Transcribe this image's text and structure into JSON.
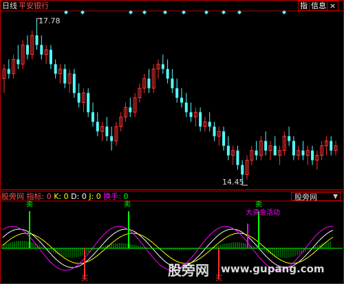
{
  "header": {
    "period": "日线",
    "stock_name": "平安银行",
    "btn_index": "指",
    "btn_info": "信息",
    "btn_close": "×"
  },
  "price_chart": {
    "high_label": "17.78",
    "low_label": "14.45",
    "colors": {
      "up": "#ff3232",
      "down": "#54ffff",
      "frame": "#c00000",
      "marker": "#54ffff"
    }
  },
  "indicator": {
    "source": "股旁网",
    "label_prefix": "指标:",
    "k_label": "0",
    "k_name": "K:",
    "d_name": "D:",
    "d_label": "0",
    "j_name": "J:",
    "j_label": "0",
    "turnover_name": "换手:",
    "turnover_value": "0",
    "selector": "股旁网",
    "sell_label": "卖",
    "buy_label": "买",
    "annotation": "大资金活动",
    "colors": {
      "k": "#ffffff",
      "d": "#ffff00",
      "j": "#ff00ff",
      "turnover": "#00ff00",
      "sell": "#00ff00",
      "buy": "#ff3232",
      "annotation": "#ff00ff"
    }
  },
  "watermark": {
    "text": "股旁网",
    "url": "www.gupang.com"
  },
  "chart_data": {
    "type": "candlestick",
    "high": 17.78,
    "low": 14.45,
    "ohlc": [
      [
        16.6,
        16.9,
        16.3,
        16.8
      ],
      [
        16.8,
        17.0,
        16.6,
        16.7
      ],
      [
        16.7,
        17.1,
        16.6,
        17.0
      ],
      [
        17.0,
        17.3,
        16.8,
        16.9
      ],
      [
        16.9,
        17.4,
        16.8,
        17.3
      ],
      [
        17.3,
        17.5,
        17.0,
        17.1
      ],
      [
        17.1,
        17.6,
        17.0,
        17.5
      ],
      [
        17.5,
        17.78,
        17.2,
        17.3
      ],
      [
        17.3,
        17.5,
        17.0,
        17.1
      ],
      [
        17.1,
        17.3,
        16.9,
        17.2
      ],
      [
        17.2,
        17.3,
        16.8,
        16.9
      ],
      [
        16.9,
        17.0,
        16.6,
        16.7
      ],
      [
        16.7,
        16.9,
        16.5,
        16.8
      ],
      [
        16.8,
        16.9,
        16.4,
        16.5
      ],
      [
        16.5,
        16.8,
        16.3,
        16.7
      ],
      [
        16.7,
        16.8,
        16.2,
        16.3
      ],
      [
        16.3,
        16.5,
        16.0,
        16.1
      ],
      [
        16.1,
        16.4,
        15.9,
        16.3
      ],
      [
        16.3,
        16.4,
        15.8,
        15.9
      ],
      [
        15.9,
        16.1,
        15.6,
        15.7
      ],
      [
        15.7,
        15.9,
        15.4,
        15.5
      ],
      [
        15.5,
        15.7,
        15.3,
        15.6
      ],
      [
        15.6,
        15.8,
        15.3,
        15.4
      ],
      [
        15.4,
        15.6,
        15.1,
        15.3
      ],
      [
        15.3,
        15.7,
        15.2,
        15.6
      ],
      [
        15.6,
        15.9,
        15.5,
        15.8
      ],
      [
        15.8,
        16.1,
        15.7,
        16.0
      ],
      [
        16.0,
        16.2,
        15.8,
        15.9
      ],
      [
        15.9,
        16.3,
        15.8,
        16.2
      ],
      [
        16.2,
        16.5,
        16.1,
        16.4
      ],
      [
        16.4,
        16.7,
        16.3,
        16.6
      ],
      [
        16.6,
        16.8,
        16.3,
        16.4
      ],
      [
        16.4,
        16.9,
        16.3,
        16.8
      ],
      [
        16.8,
        17.0,
        16.6,
        16.9
      ],
      [
        16.9,
        17.1,
        16.7,
        16.8
      ],
      [
        16.8,
        17.0,
        16.5,
        16.6
      ],
      [
        16.6,
        16.8,
        16.3,
        16.4
      ],
      [
        16.4,
        16.6,
        16.1,
        16.2
      ],
      [
        16.2,
        16.4,
        16.0,
        16.1
      ],
      [
        16.1,
        16.3,
        15.8,
        15.9
      ],
      [
        15.9,
        16.1,
        15.7,
        15.8
      ],
      [
        15.8,
        16.0,
        15.6,
        15.9
      ],
      [
        15.9,
        16.0,
        15.5,
        15.6
      ],
      [
        15.6,
        15.8,
        15.5,
        15.7
      ],
      [
        15.7,
        15.9,
        15.5,
        15.6
      ],
      [
        15.6,
        15.7,
        15.3,
        15.4
      ],
      [
        15.4,
        15.6,
        15.2,
        15.5
      ],
      [
        15.5,
        15.6,
        15.1,
        15.2
      ],
      [
        15.2,
        15.4,
        14.9,
        15.0
      ],
      [
        15.0,
        15.2,
        14.8,
        15.1
      ],
      [
        15.1,
        15.2,
        14.7,
        14.8
      ],
      [
        14.8,
        14.9,
        14.45,
        14.6
      ],
      [
        14.6,
        15.0,
        14.5,
        14.9
      ],
      [
        14.9,
        15.2,
        14.8,
        15.1
      ],
      [
        15.1,
        15.3,
        14.9,
        15.0
      ],
      [
        15.0,
        15.4,
        14.9,
        15.3
      ],
      [
        15.3,
        15.5,
        15.0,
        15.1
      ],
      [
        15.1,
        15.3,
        14.9,
        15.2
      ],
      [
        15.2,
        15.4,
        15.0,
        15.0
      ],
      [
        15.0,
        15.2,
        14.8,
        15.1
      ],
      [
        15.1,
        15.5,
        15.0,
        15.4
      ],
      [
        15.4,
        15.6,
        15.2,
        15.3
      ],
      [
        15.3,
        15.4,
        14.9,
        15.0
      ],
      [
        15.0,
        15.2,
        14.9,
        15.1
      ],
      [
        15.1,
        15.3,
        14.9,
        15.0
      ],
      [
        15.0,
        15.2,
        14.8,
        15.1
      ],
      [
        15.1,
        15.2,
        14.8,
        14.9
      ],
      [
        14.9,
        15.1,
        14.7,
        15.0
      ],
      [
        15.0,
        15.3,
        14.9,
        15.2
      ],
      [
        15.2,
        15.4,
        15.0,
        15.3
      ],
      [
        15.3,
        15.4,
        15.0,
        15.1
      ],
      [
        15.1,
        15.3,
        15.0,
        15.2
      ]
    ]
  }
}
